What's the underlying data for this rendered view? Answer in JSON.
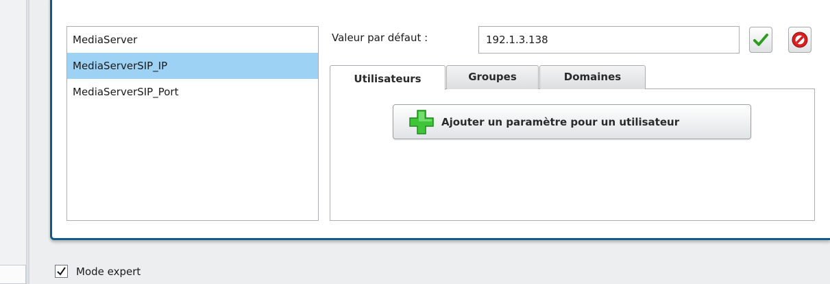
{
  "params": {
    "items": [
      {
        "label": "MediaServer",
        "selected": false
      },
      {
        "label": "MediaServerSIP_IP",
        "selected": true
      },
      {
        "label": "MediaServerSIP_Port",
        "selected": false
      }
    ]
  },
  "default_value": {
    "label": "Valeur par défaut :",
    "value": "192.1.3.138"
  },
  "actions": {
    "confirm_icon": "check-icon",
    "cancel_icon": "no-entry-icon"
  },
  "tabs": [
    {
      "label": "Utilisateurs",
      "active": true
    },
    {
      "label": "Groupes",
      "active": false
    },
    {
      "label": "Domaines",
      "active": false
    }
  ],
  "add_button": {
    "label": "Ajouter un paramètre pour un utilisateur",
    "icon": "plus-icon"
  },
  "mode_expert": {
    "label": "Mode expert",
    "checked": true
  },
  "colors": {
    "accent": "#0f5a87",
    "selected_row": "#9dd2f5",
    "confirm": "#2e9d1f",
    "cancel": "#d81e1e",
    "add_plus": "#3fc43a"
  }
}
